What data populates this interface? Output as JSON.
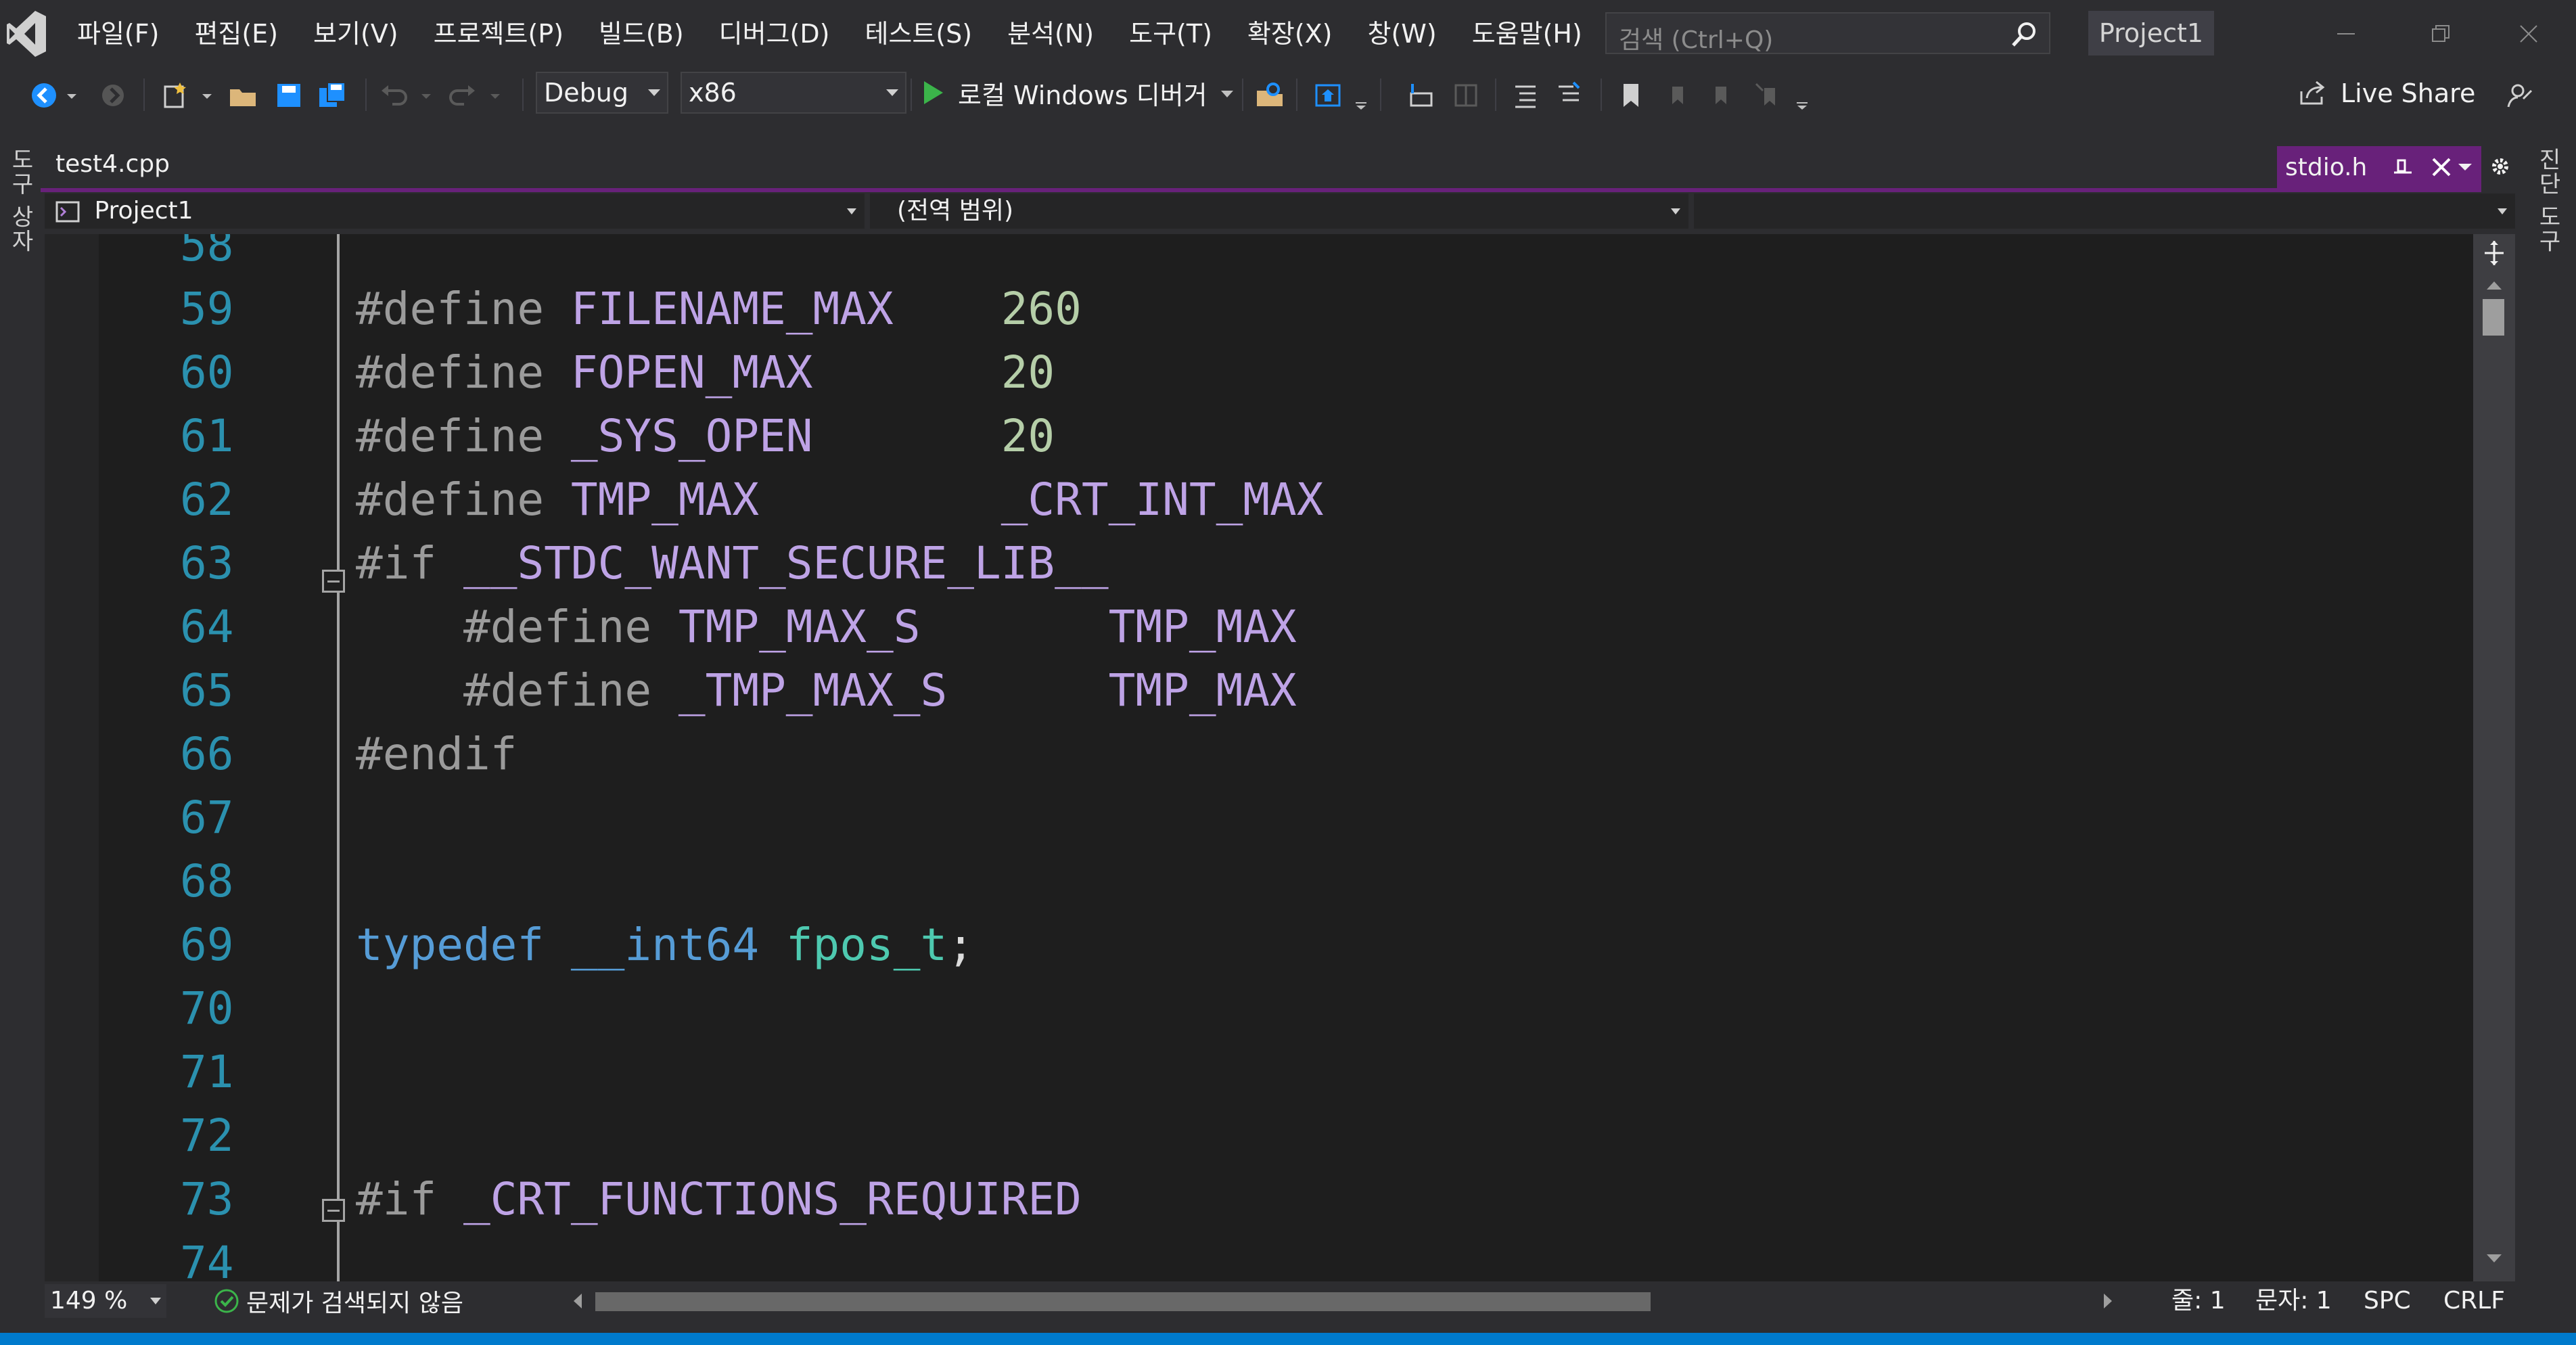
{
  "menu": [
    "파일(F)",
    "편집(E)",
    "보기(V)",
    "프로젝트(P)",
    "빌드(B)",
    "디버그(D)",
    "테스트(S)",
    "분석(N)",
    "도구(T)",
    "확장(X)",
    "창(W)",
    "도움말(H)"
  ],
  "search": {
    "placeholder": "검색 (Ctrl+Q)"
  },
  "title": "Project1",
  "toolbar": {
    "config": "Debug",
    "platform": "x86",
    "run_label": "로컬 Windows 디버거",
    "live_share": "Live Share"
  },
  "side": {
    "left": "도구 상자",
    "right": "진단 도구"
  },
  "tabs": {
    "file": "test4.cpp",
    "preview": "stdio.h"
  },
  "nav": {
    "project": "Project1",
    "scope": "(전역 범위)"
  },
  "code_lines": [
    {
      "n": "58",
      "text": ""
    },
    {
      "n": "59",
      "text": "#define FILENAME_MAX    260"
    },
    {
      "n": "60",
      "text": "#define FOPEN_MAX       20"
    },
    {
      "n": "61",
      "text": "#define _SYS_OPEN       20"
    },
    {
      "n": "62",
      "text": "#define TMP_MAX         _CRT_INT_MAX"
    },
    {
      "n": "63",
      "text": "#if __STDC_WANT_SECURE_LIB__"
    },
    {
      "n": "64",
      "text": "    #define TMP_MAX_S       TMP_MAX"
    },
    {
      "n": "65",
      "text": "    #define _TMP_MAX_S      TMP_MAX"
    },
    {
      "n": "66",
      "text": "#endif"
    },
    {
      "n": "67",
      "text": ""
    },
    {
      "n": "68",
      "text": ""
    },
    {
      "n": "69",
      "text": "typedef __int64 fpos_t;"
    },
    {
      "n": "70",
      "text": ""
    },
    {
      "n": "71",
      "text": ""
    },
    {
      "n": "72",
      "text": ""
    },
    {
      "n": "73",
      "text": "#if _CRT_FUNCTIONS_REQUIRED"
    },
    {
      "n": "74",
      "text": ""
    }
  ],
  "status": {
    "zoom": "149 %",
    "issues": "문제가 검색되지 않음",
    "line": "줄: 1",
    "char": "문자: 1",
    "spc": "SPC",
    "eol": "CRLF"
  },
  "colors": {
    "accent": "#68217a",
    "statusbar": "#007acc",
    "linenumber": "#2b91af",
    "macro": "#bea3e6",
    "number": "#b5cea8",
    "keyword": "#569cd6",
    "type": "#4ec9b0"
  }
}
